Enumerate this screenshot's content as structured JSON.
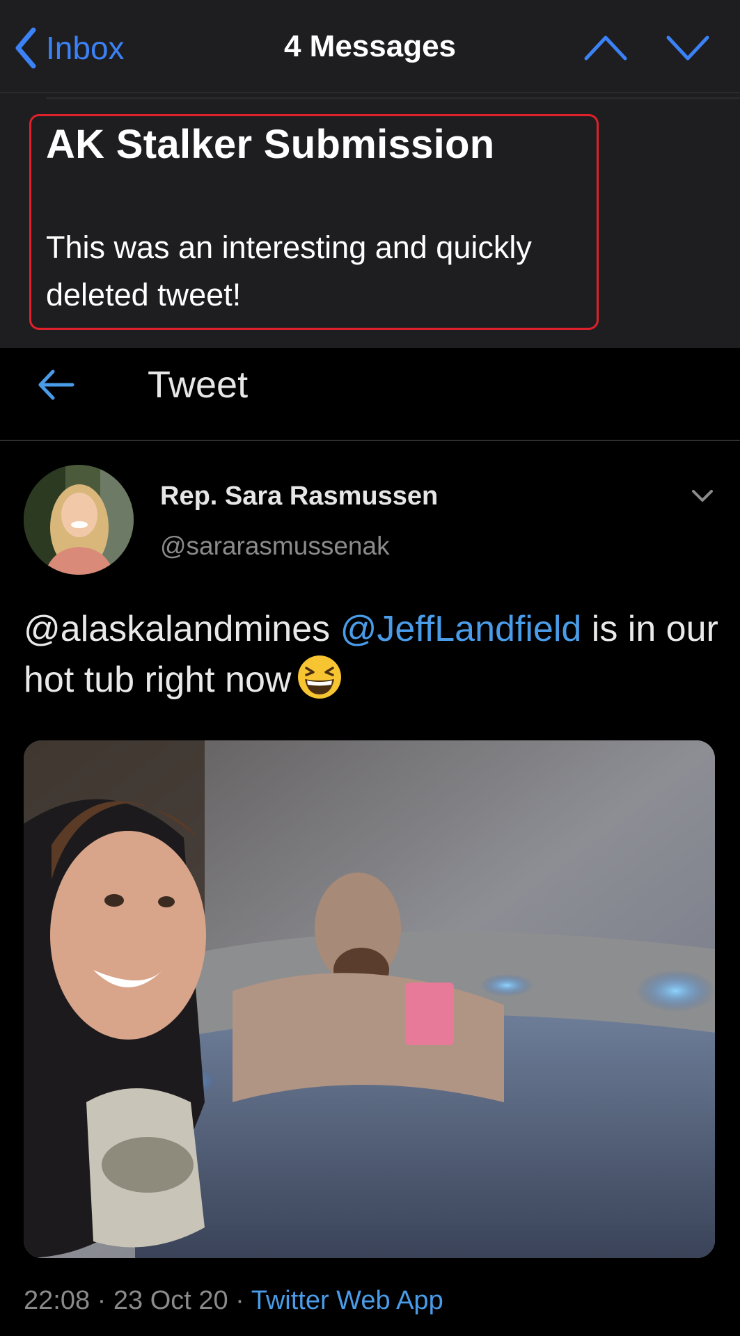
{
  "mail_nav": {
    "back_label": "Inbox",
    "title": "4 Messages"
  },
  "email": {
    "subject": "AK Stalker Submission",
    "body": "This was an interesting and quickly deleted tweet!"
  },
  "tweet_header": {
    "title": "Tweet"
  },
  "tweet": {
    "author_name": "Rep. Sara Rasmussen",
    "author_handle": "@sararasmussenak",
    "text_part1": "@alaskalandmines ",
    "mention": "@JeffLandfield",
    "text_part2": " is in our hot tub right now",
    "time": "22:08 · 23 Oct 20 · ",
    "source": "Twitter Web App"
  },
  "colors": {
    "accent": "#3b82f6",
    "link": "#4a9ce8",
    "highlight_border": "#e0202a",
    "mail_bg": "#1e1e20",
    "tweet_bg": "#000000"
  },
  "icons": {
    "back": "chevron-left-icon",
    "prev": "chevron-up-icon",
    "next": "chevron-down-icon",
    "tweet_back": "arrow-left-icon",
    "tweet_menu": "caret-down-icon",
    "emoji": "grinning-squinting-face-emoji"
  }
}
